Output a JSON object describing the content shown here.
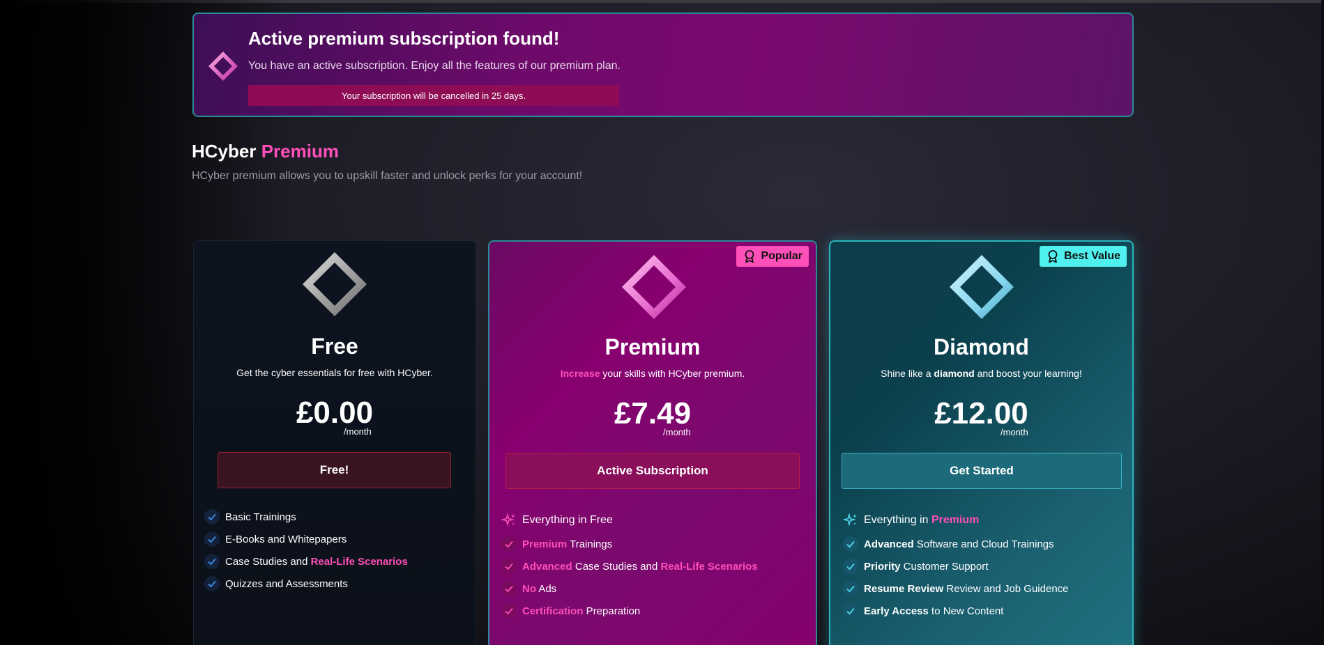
{
  "banner": {
    "title": "Active premium subscription found!",
    "text": "You have an active subscription. Enjoy all the features of our premium plan.",
    "notice": "Your subscription will be cancelled in 25 days."
  },
  "heading": {
    "brand": "HCyber",
    "accent": "Premium",
    "subtitle": "HCyber premium allows you to upskill faster and unlock perks for your account!"
  },
  "colors": {
    "pink_accent": "#ff4fb8",
    "cyan_accent": "#4ff0ee",
    "premium_bg": "#88006f",
    "diamond_bg": "#0b3f4c"
  },
  "plans": {
    "free": {
      "name": "Free",
      "desc": "Get the cyber essentials for free with HCyber.",
      "price": "£0.00",
      "per": "/month",
      "cta": "Free!",
      "icon": "diamond-gray-icon",
      "features": {
        "f1": "Basic Trainings",
        "f2": "E-Books and Whitepapers",
        "f3a": "Case Studies and ",
        "f3b": "Real-Life Scenarios",
        "f4": "Quizzes and Assessments"
      }
    },
    "premium": {
      "badge": "Popular",
      "name": "Premium",
      "desc_accent": "Increase",
      "desc_rest": " your skills with HCyber premium.",
      "price": "£7.49",
      "per": "/month",
      "cta": "Active Subscription",
      "icon": "diamond-pink-icon",
      "features": {
        "f0": "Everything in Free",
        "f1a": "Premium",
        "f1b": " Trainings",
        "f2a": "Advanced",
        "f2b": " Case Studies and ",
        "f2c": "Real-Life Scenarios",
        "f3a": "No",
        "f3b": " Ads",
        "f4a": "Certification",
        "f4b": " Preparation"
      }
    },
    "diamond": {
      "badge": "Best Value",
      "name": "Diamond",
      "desc_a": "Shine like a ",
      "desc_b": "diamond",
      "desc_c": " and boost your learning!",
      "price": "£12.00",
      "per": "/month",
      "cta": "Get Started",
      "icon": "diamond-cyan-icon",
      "features": {
        "f0a": "Everything in ",
        "f0b": "Premium",
        "f1a": "Advanced",
        "f1b": " Software and Cloud Trainings",
        "f2a": "Priority",
        "f2b": " Customer Support",
        "f3a": "Resume Review",
        "f3b": " Review and Job Guidence",
        "f4a": "Early Access",
        "f4b": " to New Content"
      }
    }
  }
}
